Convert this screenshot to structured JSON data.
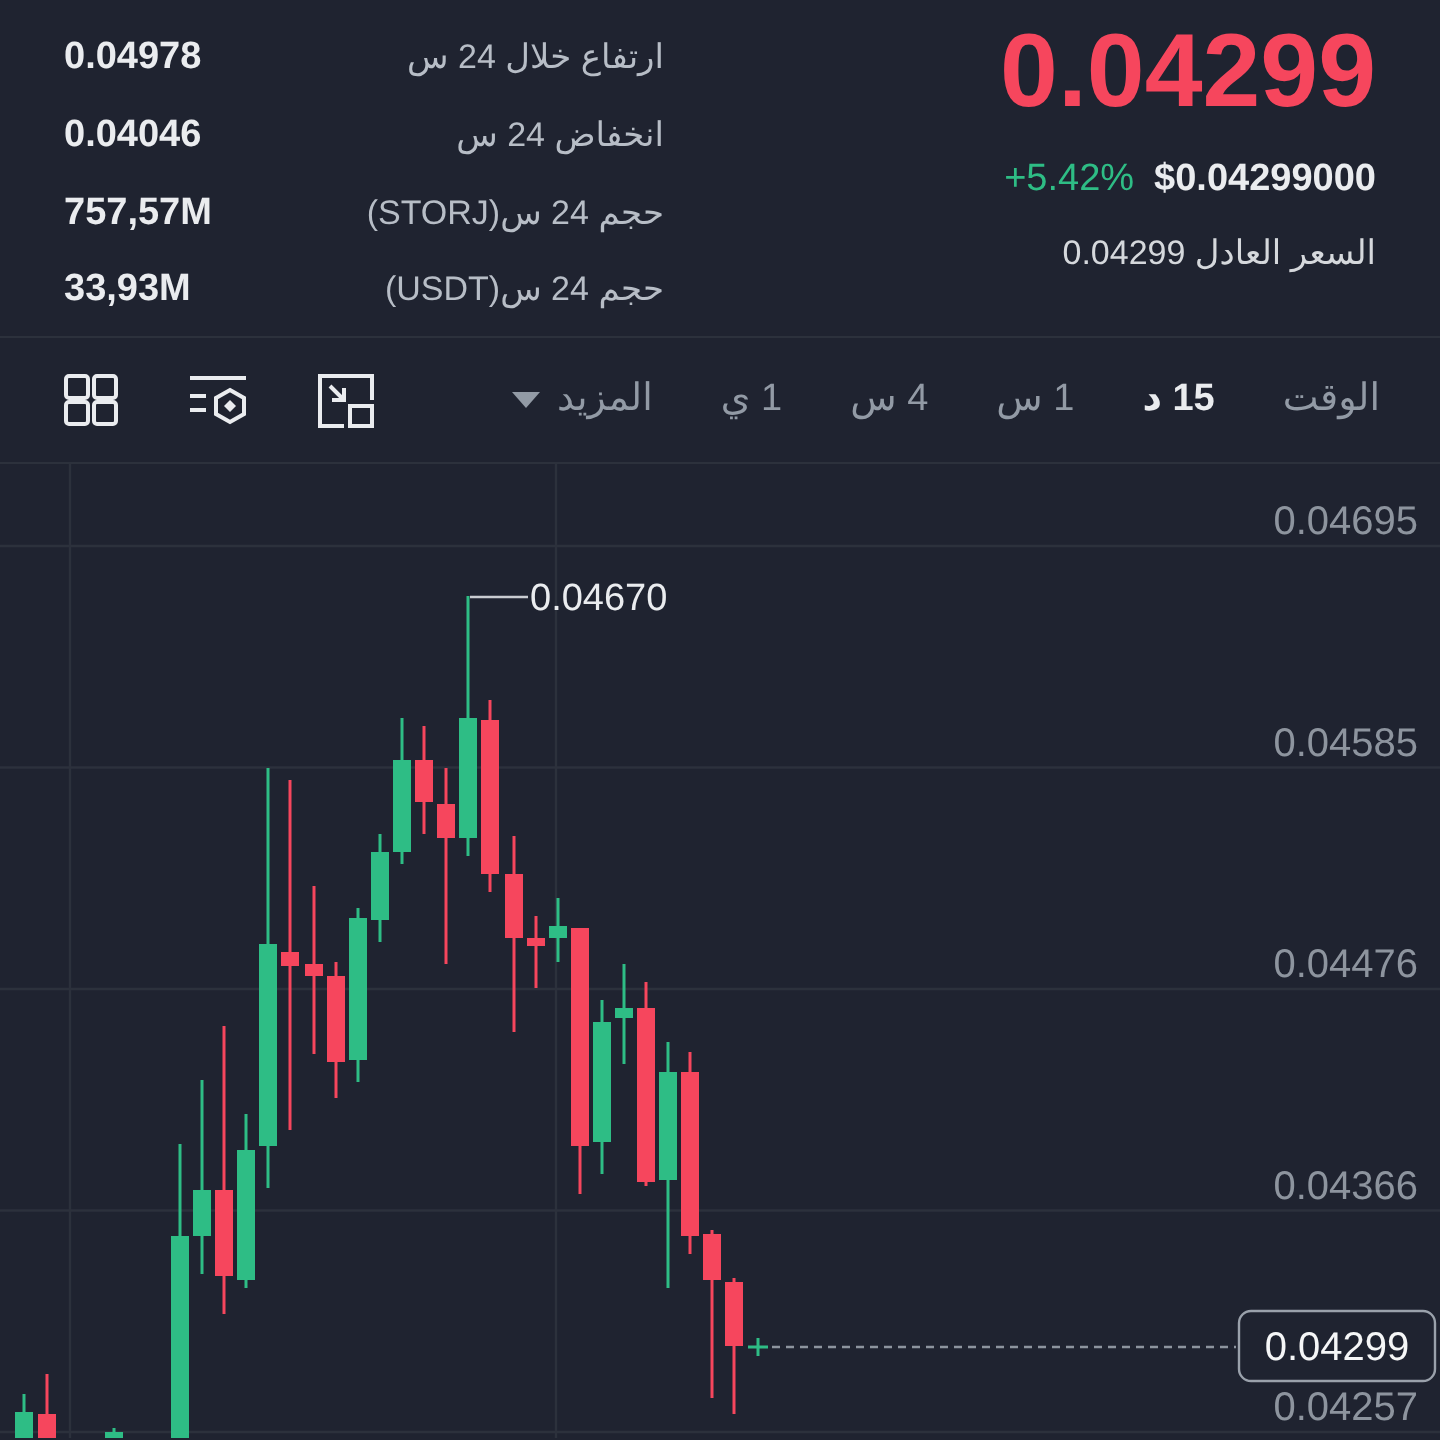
{
  "stats": [
    {
      "label": "ارتفاع خلال 24 س",
      "value": "0.04978"
    },
    {
      "label": "انخفاض 24 س",
      "value": "0.04046"
    },
    {
      "label": "حجم 24 س(STORJ)",
      "value": "757,57M"
    },
    {
      "label": "حجم 24 س(USDT)",
      "value": "33,93M"
    }
  ],
  "price": {
    "last": "0.04299",
    "last_falling": true,
    "change": "+5.42%",
    "change_rising": true,
    "usd_price": "$0.04299000",
    "fair_price": "السعر العادل 0.04299"
  },
  "toolbar": {
    "time_label": "الوقت",
    "intervals": [
      {
        "label": "15 د",
        "selected": true
      },
      {
        "label": "1 س",
        "selected": false
      },
      {
        "label": "4 س",
        "selected": false
      },
      {
        "label": "1 ي",
        "selected": false
      }
    ],
    "more": {
      "label": "المزيد"
    }
  },
  "chart": {
    "y_axis_labels": [
      "0.04695",
      "0.04585",
      "0.04476",
      "0.04366",
      "0.04257"
    ],
    "high_label": "0.04670",
    "last_price_tag": "0.04299"
  }
}
